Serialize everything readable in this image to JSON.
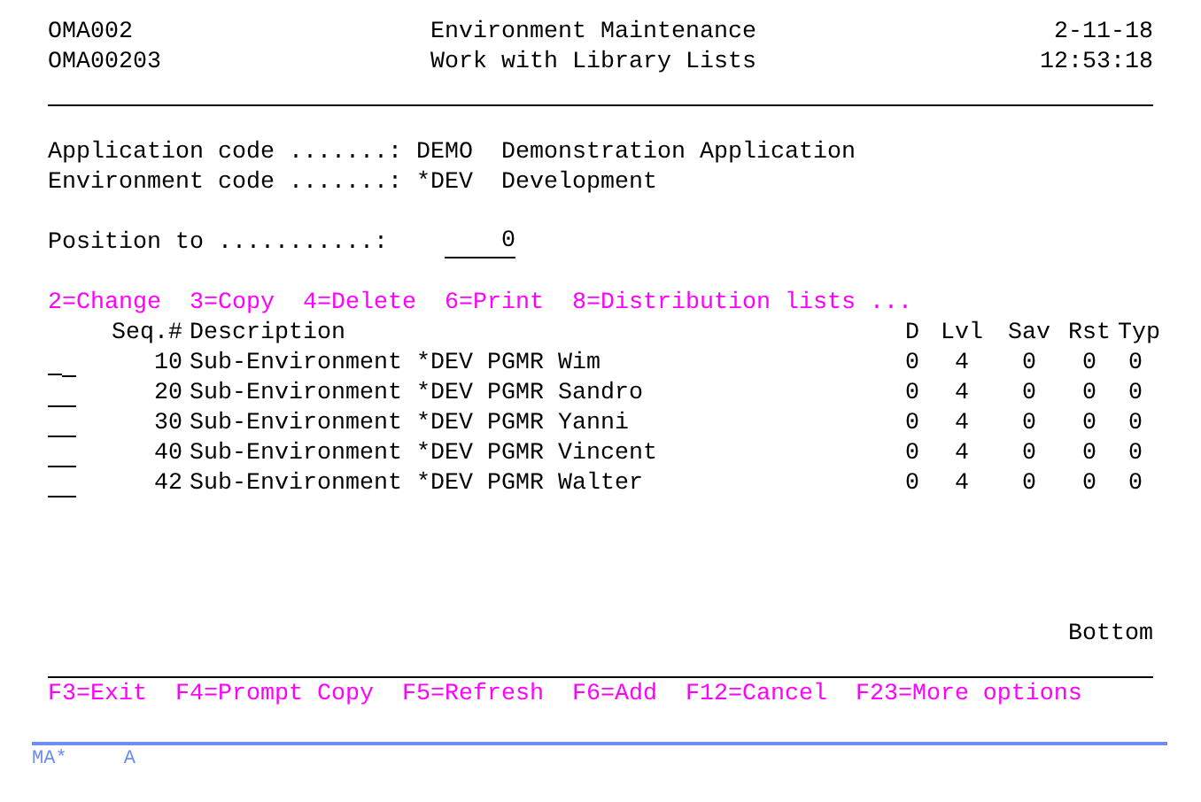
{
  "header": {
    "program": "OMA002",
    "screen_id": "OMA00203",
    "title": "Environment Maintenance",
    "subtitle": "Work with Library Lists",
    "date": "2-11-18",
    "time": "12:53:18"
  },
  "fields": [
    {
      "label": "Application code .......:",
      "value": "DEMO",
      "description": "Demonstration Application"
    },
    {
      "label": "Environment code .......:",
      "value": "*DEV",
      "description": "Development"
    }
  ],
  "position_to": {
    "label": "Position to ...........:",
    "value": "0"
  },
  "options": [
    "2=Change",
    "3=Copy",
    "4=Delete",
    "6=Print",
    "8=Distribution lists ..."
  ],
  "table": {
    "columns": [
      "Seq.#",
      "Description",
      "D",
      "Lvl",
      "Sav",
      "Rst",
      "Typ"
    ],
    "rows": [
      {
        "focused": true,
        "cells": [
          "10",
          "Sub-Environment *DEV PGMR Wim",
          "0",
          "4",
          "0",
          "0",
          "0"
        ]
      },
      {
        "focused": false,
        "cells": [
          "20",
          "Sub-Environment *DEV PGMR Sandro",
          "0",
          "4",
          "0",
          "0",
          "0"
        ]
      },
      {
        "focused": false,
        "cells": [
          "30",
          "Sub-Environment *DEV PGMR Yanni",
          "0",
          "4",
          "0",
          "0",
          "0"
        ]
      },
      {
        "focused": false,
        "cells": [
          "40",
          "Sub-Environment *DEV PGMR Vincent",
          "0",
          "4",
          "0",
          "0",
          "0"
        ]
      },
      {
        "focused": false,
        "cells": [
          "42",
          "Sub-Environment *DEV PGMR Walter",
          "0",
          "4",
          "0",
          "0",
          "0"
        ]
      }
    ]
  },
  "more_indicator": "Bottom",
  "function_keys": [
    "F3=Exit",
    "F4=Prompt Copy",
    "F5=Refresh",
    "F6=Add",
    "F12=Cancel",
    "F23=More options"
  ],
  "status_bar": {
    "session": "MA*",
    "mode": "A"
  }
}
